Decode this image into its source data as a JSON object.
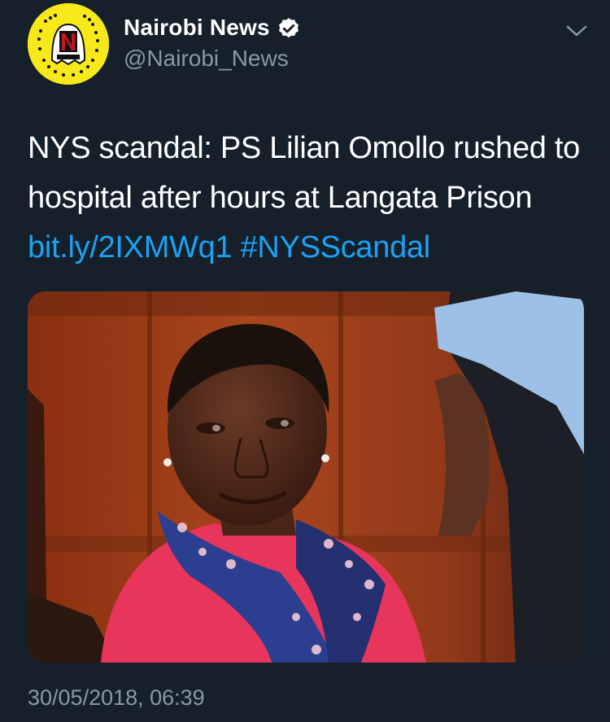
{
  "author": {
    "display_name": "Nairobi News",
    "handle": "@Nairobi_News",
    "verified": true,
    "avatar_icon": "snapcode-logo-icon"
  },
  "tweet": {
    "text_main": "NYS scandal: PS Lilian Omollo rushed to hospital after hours at Langata Prison",
    "link": "bit.ly/2IXMWq1",
    "hashtag": "#NYSScandal",
    "timestamp": "30/05/2018, 06:39"
  },
  "colors": {
    "background": "#15202b",
    "link": "#1da1f2",
    "secondary_text": "#8899a6",
    "avatar_yellow": "#f7e81a"
  },
  "icons": {
    "verified": "verified-badge-icon",
    "menu": "chevron-down-icon"
  }
}
